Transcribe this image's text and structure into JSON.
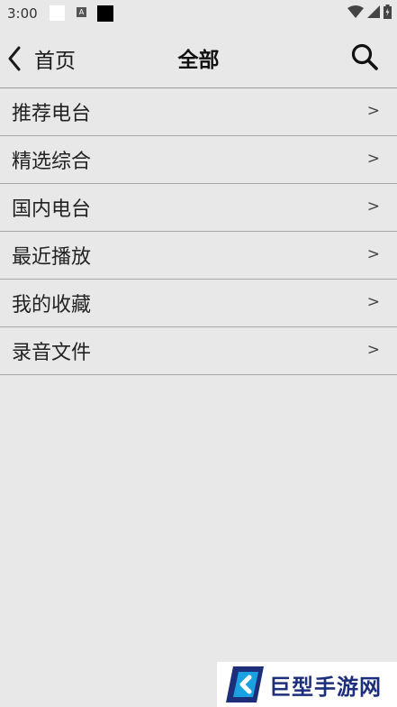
{
  "status_bar": {
    "time": "3:00",
    "notification_icon_letter": "A"
  },
  "header": {
    "back_label": "首页",
    "title": "全部"
  },
  "menu": {
    "items": [
      {
        "label": "推荐电台",
        "arrow": ">"
      },
      {
        "label": "精选综合",
        "arrow": ">"
      },
      {
        "label": "国内电台",
        "arrow": ">"
      },
      {
        "label": "最近播放",
        "arrow": ">"
      },
      {
        "label": "我的收藏",
        "arrow": ">"
      },
      {
        "label": "录音文件",
        "arrow": ">"
      }
    ]
  },
  "watermark": {
    "text": "巨型手游网"
  },
  "colors": {
    "background": "#e8e8e8",
    "divider": "#a8a8a8",
    "watermark_blue": "#1d2f7a",
    "watermark_cyan": "#1ba0e2"
  }
}
